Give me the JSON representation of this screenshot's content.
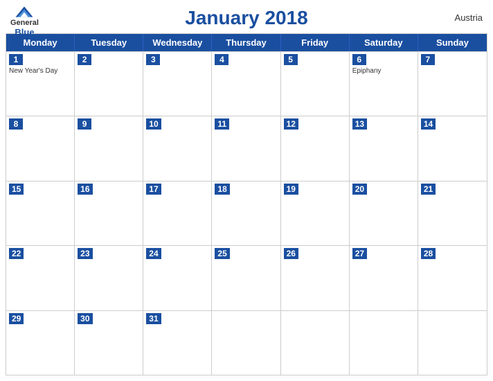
{
  "header": {
    "title": "January 2018",
    "country": "Austria",
    "logo": {
      "general": "General",
      "blue": "Blue"
    }
  },
  "days": [
    "Monday",
    "Tuesday",
    "Wednesday",
    "Thursday",
    "Friday",
    "Saturday",
    "Sunday"
  ],
  "weeks": [
    [
      {
        "num": "1",
        "holiday": "New Year's Day"
      },
      {
        "num": "2",
        "holiday": ""
      },
      {
        "num": "3",
        "holiday": ""
      },
      {
        "num": "4",
        "holiday": ""
      },
      {
        "num": "5",
        "holiday": ""
      },
      {
        "num": "6",
        "holiday": "Epiphany"
      },
      {
        "num": "7",
        "holiday": ""
      }
    ],
    [
      {
        "num": "8",
        "holiday": ""
      },
      {
        "num": "9",
        "holiday": ""
      },
      {
        "num": "10",
        "holiday": ""
      },
      {
        "num": "11",
        "holiday": ""
      },
      {
        "num": "12",
        "holiday": ""
      },
      {
        "num": "13",
        "holiday": ""
      },
      {
        "num": "14",
        "holiday": ""
      }
    ],
    [
      {
        "num": "15",
        "holiday": ""
      },
      {
        "num": "16",
        "holiday": ""
      },
      {
        "num": "17",
        "holiday": ""
      },
      {
        "num": "18",
        "holiday": ""
      },
      {
        "num": "19",
        "holiday": ""
      },
      {
        "num": "20",
        "holiday": ""
      },
      {
        "num": "21",
        "holiday": ""
      }
    ],
    [
      {
        "num": "22",
        "holiday": ""
      },
      {
        "num": "23",
        "holiday": ""
      },
      {
        "num": "24",
        "holiday": ""
      },
      {
        "num": "25",
        "holiday": ""
      },
      {
        "num": "26",
        "holiday": ""
      },
      {
        "num": "27",
        "holiday": ""
      },
      {
        "num": "28",
        "holiday": ""
      }
    ],
    [
      {
        "num": "29",
        "holiday": ""
      },
      {
        "num": "30",
        "holiday": ""
      },
      {
        "num": "31",
        "holiday": ""
      },
      {
        "num": "",
        "holiday": ""
      },
      {
        "num": "",
        "holiday": ""
      },
      {
        "num": "",
        "holiday": ""
      },
      {
        "num": "",
        "holiday": ""
      }
    ]
  ]
}
